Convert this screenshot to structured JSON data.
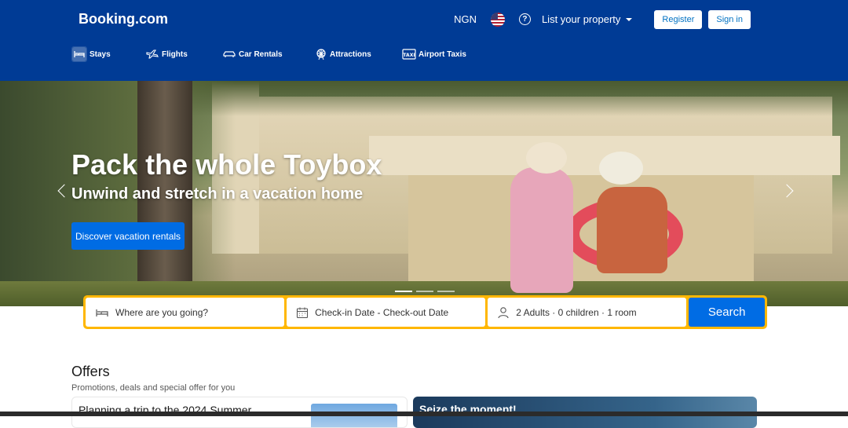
{
  "header": {
    "logo": "Booking.com",
    "currency": "NGN",
    "flag_icon": "us-flag-icon",
    "help_icon": "question-circle-icon",
    "list_property": "List your property",
    "register": "Register",
    "sign_in": "Sign in",
    "background": "#003b95"
  },
  "nav": {
    "items": [
      {
        "label": "Stays",
        "icon": "bed-icon"
      },
      {
        "label": "Flights",
        "icon": "plane-icon"
      },
      {
        "label": "Car Rentals",
        "icon": "car-icon"
      },
      {
        "label": "Attractions",
        "icon": "ferris-wheel-icon"
      },
      {
        "label": "Airport Taxis",
        "icon": "taxi-icon"
      }
    ]
  },
  "hero": {
    "title": "Pack the whole Toybox",
    "subtitle": "Unwind and stretch in a vacation home",
    "cta": "Discover vacation rentals",
    "slides": 3,
    "active_slide": 1
  },
  "search": {
    "destination_placeholder": "Where are you going?",
    "dates_checkin": "Check-in Date",
    "dates_sep": " - ",
    "dates_checkout": "Check-out Date",
    "guests_adults": "2 Adults",
    "guests_children": "0 children",
    "guests_rooms": "1 room",
    "guests_sep": " · ",
    "search_button": "Search",
    "border_color": "#ffb700",
    "button_color": "#006ce4"
  },
  "offers": {
    "title": "Offers",
    "subtitle": "Promotions, deals and special offer for you",
    "cards": [
      {
        "text": "Planning a trip to the 2024 Summer"
      },
      {
        "text": "Seize the moment!"
      }
    ]
  }
}
